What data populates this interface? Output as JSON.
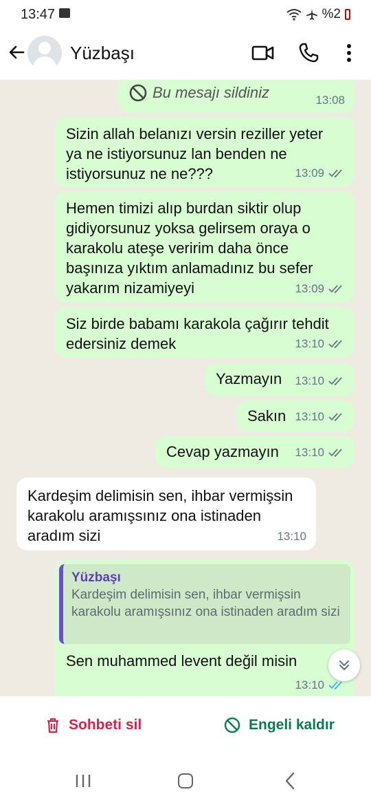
{
  "status": {
    "time": "13:47",
    "battery": "%2"
  },
  "header": {
    "name": "Yüzbaşı"
  },
  "messages": [
    {
      "text": "Bu mesajı sildiniz",
      "time": "13:08"
    },
    {
      "text": "Sizin allah belanızı versin reziller yeter ya ne istiyorsunuz lan benden ne istiyorsunuz ne ne???",
      "time": "13:09"
    },
    {
      "text": "Hemen timizi alıp burdan siktir olup gidiyorsunuz yoksa gelirsem oraya o karakolu ateşe veririm daha önce başınıza yıktım anlamadınız bu sefer yakarım nizamiyeyi",
      "time": "13:09"
    },
    {
      "text": "Siz birde babamı karakola çağırır tehdit edersiniz demek",
      "time": "13:10"
    },
    {
      "text": "Yazmayın",
      "time": "13:10"
    },
    {
      "text": "Sakın",
      "time": "13:10"
    },
    {
      "text": "Cevap yazmayın",
      "time": "13:10"
    },
    {
      "text": "Kardeşim delimisin sen, ihbar vermişsin karakolu aramışsınız ona istinaden aradım sizi",
      "time": "13:10"
    },
    {
      "text": "Sen muhammed levent değil misin",
      "time": "13:10"
    }
  ],
  "quote": {
    "name": "Yüzbaşı",
    "text": "Kardeşim delimisin sen, ihbar vermişsin karakolu aramışsınız ona istinaden aradım sizi"
  },
  "actions": {
    "delete_label": "Sohbeti sil",
    "unblock_label": "Engeli kaldır"
  },
  "colors": {
    "delete": "#d0244d",
    "unblock": "#0b7a52",
    "read_check": "#34b7f1",
    "outgoing": "#d9fdd3",
    "incoming": "#ffffff"
  }
}
